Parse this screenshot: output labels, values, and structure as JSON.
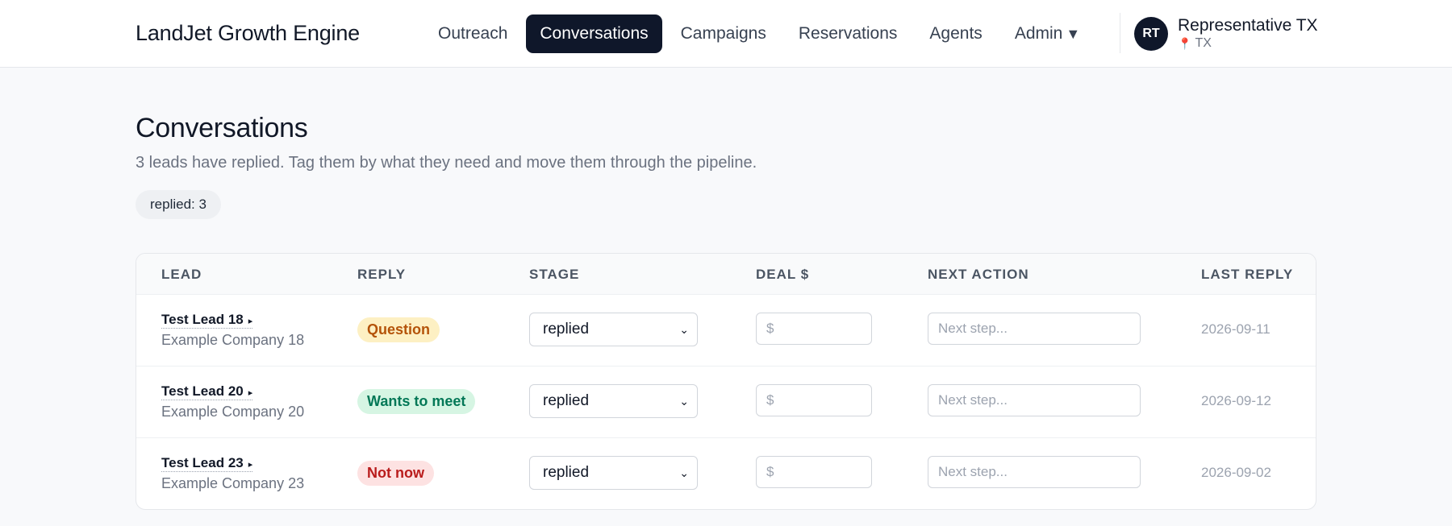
{
  "header": {
    "brand": "LandJet Growth Engine",
    "nav": [
      {
        "label": "Outreach",
        "active": false
      },
      {
        "label": "Conversations",
        "active": true
      },
      {
        "label": "Campaigns",
        "active": false
      },
      {
        "label": "Reservations",
        "active": false
      },
      {
        "label": "Agents",
        "active": false
      },
      {
        "label": "Admin",
        "active": false,
        "caret": "▼"
      }
    ],
    "user": {
      "initials": "RT",
      "name": "Representative TX",
      "location": "TX",
      "location_icon": "pin-icon"
    }
  },
  "main": {
    "title": "Conversations",
    "subtitle": "3 leads have replied. Tag them by what they need and move them through the pipeline.",
    "chip": "replied: 3"
  },
  "table": {
    "headers": {
      "lead": "Lead",
      "reply": "Reply",
      "stage": "Stage",
      "deal": "Deal $",
      "next_action": "Next Action",
      "last_reply": "Last Reply"
    },
    "rows": [
      {
        "name": "Test Lead 18",
        "company": "Example Company 18",
        "reply": "Question",
        "reply_type": "question",
        "stage": "replied",
        "deal_placeholder": "$",
        "next_placeholder": "Next step...",
        "last_reply": "2026-09-11"
      },
      {
        "name": "Test Lead 20",
        "company": "Example Company 20",
        "reply": "Wants to meet",
        "reply_type": "meet",
        "stage": "replied",
        "deal_placeholder": "$",
        "next_placeholder": "Next step...",
        "last_reply": "2026-09-12"
      },
      {
        "name": "Test Lead 23",
        "company": "Example Company 23",
        "reply": "Not now",
        "reply_type": "notnow",
        "stage": "replied",
        "deal_placeholder": "$",
        "next_placeholder": "Next step...",
        "last_reply": "2026-09-02"
      }
    ]
  },
  "colors": {
    "primary": "#0f172a",
    "question_bg": "#fdf0c3",
    "question_fg": "#b45309",
    "meet_bg": "#d6f5e3",
    "meet_fg": "#047857",
    "notnow_bg": "#fde2e2",
    "notnow_fg": "#b91c1c"
  }
}
